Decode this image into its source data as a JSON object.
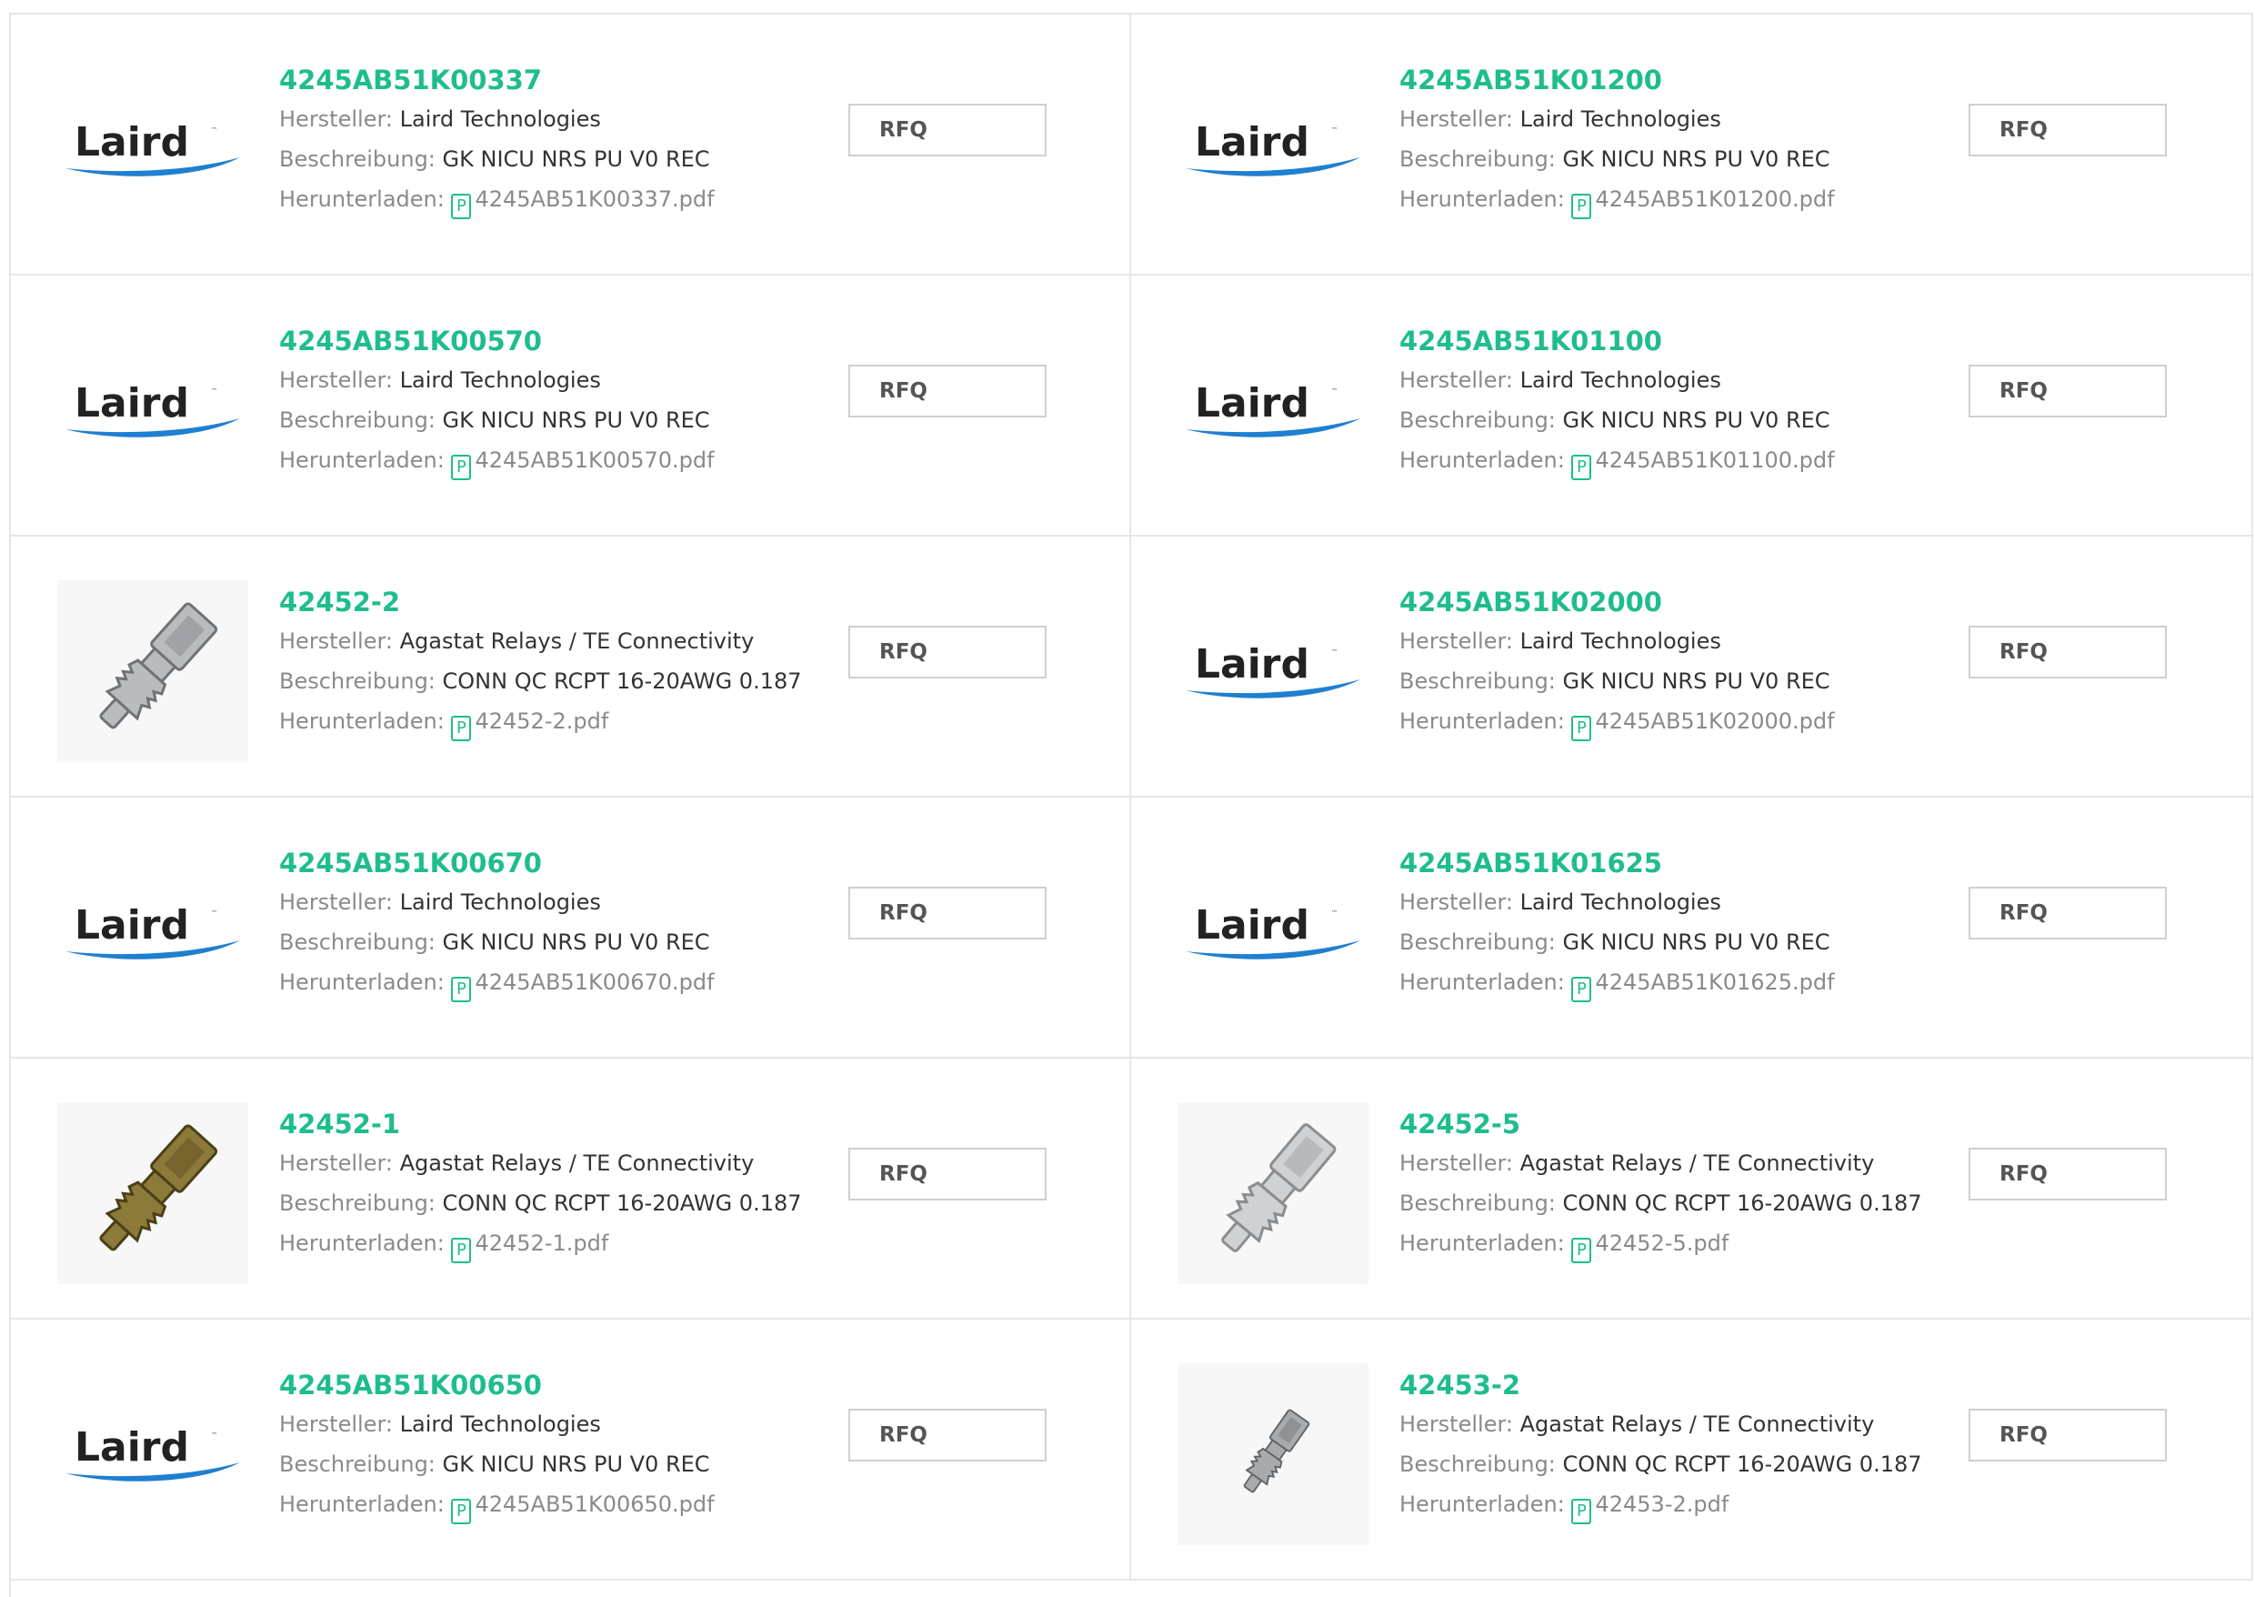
{
  "labels": {
    "manufacturer": "Hersteller:",
    "description": "Beschreibung:",
    "download": "Herunterladen:",
    "rfq": "RFQ",
    "pdf_glyph": "P"
  },
  "colors": {
    "accent": "#1fbd8e",
    "laird_blue": "#1f7fd0",
    "border": "#e6e6e6"
  },
  "products": [
    {
      "part": "4245AB51K00337",
      "manufacturer": "Laird Technologies",
      "description": "GK NICU NRS PU V0 REC",
      "file": "4245AB51K00337.pdf",
      "image": "laird-logo",
      "logo_text": "Laird"
    },
    {
      "part": "4245AB51K01200",
      "manufacturer": "Laird Technologies",
      "description": "GK NICU NRS PU V0 REC",
      "file": "4245AB51K01200.pdf",
      "image": "laird-logo",
      "logo_text": "Laird"
    },
    {
      "part": "4245AB51K00570",
      "manufacturer": "Laird Technologies",
      "description": "GK NICU NRS PU V0 REC",
      "file": "4245AB51K00570.pdf",
      "image": "laird-logo",
      "logo_text": "Laird"
    },
    {
      "part": "4245AB51K01100",
      "manufacturer": "Laird Technologies",
      "description": "GK NICU NRS PU V0 REC",
      "file": "4245AB51K01100.pdf",
      "image": "laird-logo",
      "logo_text": "Laird"
    },
    {
      "part": "42452-2",
      "manufacturer": "Agastat Relays / TE Connectivity",
      "description": "CONN QC RCPT 16-20AWG 0.187",
      "file": "42452-2.pdf",
      "image": "terminal-silver"
    },
    {
      "part": "4245AB51K02000",
      "manufacturer": "Laird Technologies",
      "description": "GK NICU NRS PU V0 REC",
      "file": "4245AB51K02000.pdf",
      "image": "laird-logo",
      "logo_text": "Laird"
    },
    {
      "part": "4245AB51K00670",
      "manufacturer": "Laird Technologies",
      "description": "GK NICU NRS PU V0 REC",
      "file": "4245AB51K00670.pdf",
      "image": "laird-logo",
      "logo_text": "Laird"
    },
    {
      "part": "4245AB51K01625",
      "manufacturer": "Laird Technologies",
      "description": "GK NICU NRS PU V0 REC",
      "file": "4245AB51K01625.pdf",
      "image": "laird-logo",
      "logo_text": "Laird"
    },
    {
      "part": "42452-1",
      "manufacturer": "Agastat Relays / TE Connectivity",
      "description": "CONN QC RCPT 16-20AWG 0.187",
      "file": "42452-1.pdf",
      "image": "terminal-brass"
    },
    {
      "part": "42452-5",
      "manufacturer": "Agastat Relays / TE Connectivity",
      "description": "CONN QC RCPT 16-20AWG 0.187",
      "file": "42452-5.pdf",
      "image": "terminal-open"
    },
    {
      "part": "4245AB51K00650",
      "manufacturer": "Laird Technologies",
      "description": "GK NICU NRS PU V0 REC",
      "file": "4245AB51K00650.pdf",
      "image": "laird-logo",
      "logo_text": "Laird"
    },
    {
      "part": "42453-2",
      "manufacturer": "Agastat Relays / TE Connectivity",
      "description": "CONN QC RCPT 16-20AWG 0.187",
      "file": "42453-2.pdf",
      "image": "terminal-small"
    }
  ]
}
